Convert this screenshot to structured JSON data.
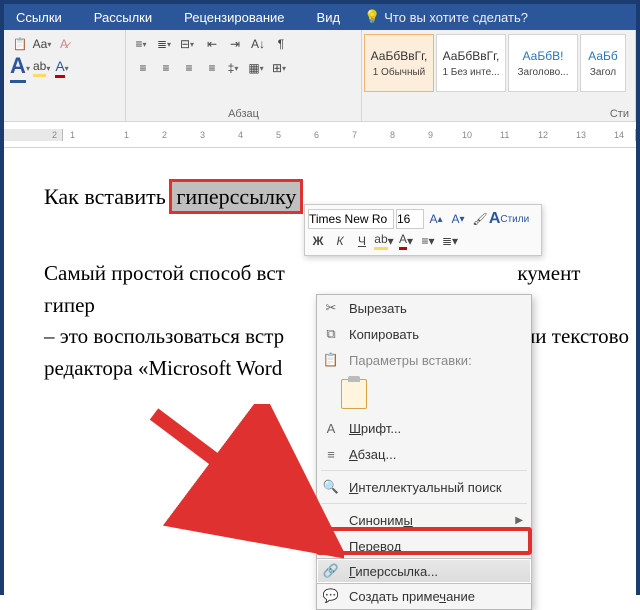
{
  "tabs": {
    "items": [
      "Ссылки",
      "Рассылки",
      "Рецензирование",
      "Вид"
    ],
    "tell_me": "Что вы хотите сделать?"
  },
  "ribbon": {
    "para_label": "Абзац",
    "styles_label": "Сти",
    "styles": [
      {
        "sample": "АаБбВвГг,",
        "name": "1 Обычный",
        "selected": true
      },
      {
        "sample": "АаБбВвГг,",
        "name": "1 Без инте...",
        "selected": false
      },
      {
        "sample": "АаБбВ!",
        "name": "Заголово...",
        "selected": false,
        "blue": true
      },
      {
        "sample": "АаБб",
        "name": "Загол",
        "selected": false,
        "blue": true
      }
    ]
  },
  "document": {
    "title_pre": "Как вставить ",
    "title_hl": "гиперссылку",
    "body1a": "Самый простой способ вст",
    "body1b": "кумент гипер",
    "body2a": "– это воспользоваться встр",
    "body2b": "ами текстово",
    "body3": "редактора «Microsoft Word"
  },
  "mini_toolbar": {
    "font": "Times New Ro",
    "size": "16",
    "bold": "Ж",
    "italic": "К",
    "underline": "Ч",
    "styles": "Стили"
  },
  "context_menu": {
    "cut": "Вырезать",
    "copy": "Копировать",
    "paste_header": "Параметры вставки:",
    "font": "Шрифт...",
    "paragraph": "Абзац...",
    "smart_lookup": "Интеллектуальный поиск",
    "synonyms": "Синонимы",
    "translate": "Перевод",
    "hyperlink": "Гиперссылка...",
    "comment": "Создать примечание"
  }
}
